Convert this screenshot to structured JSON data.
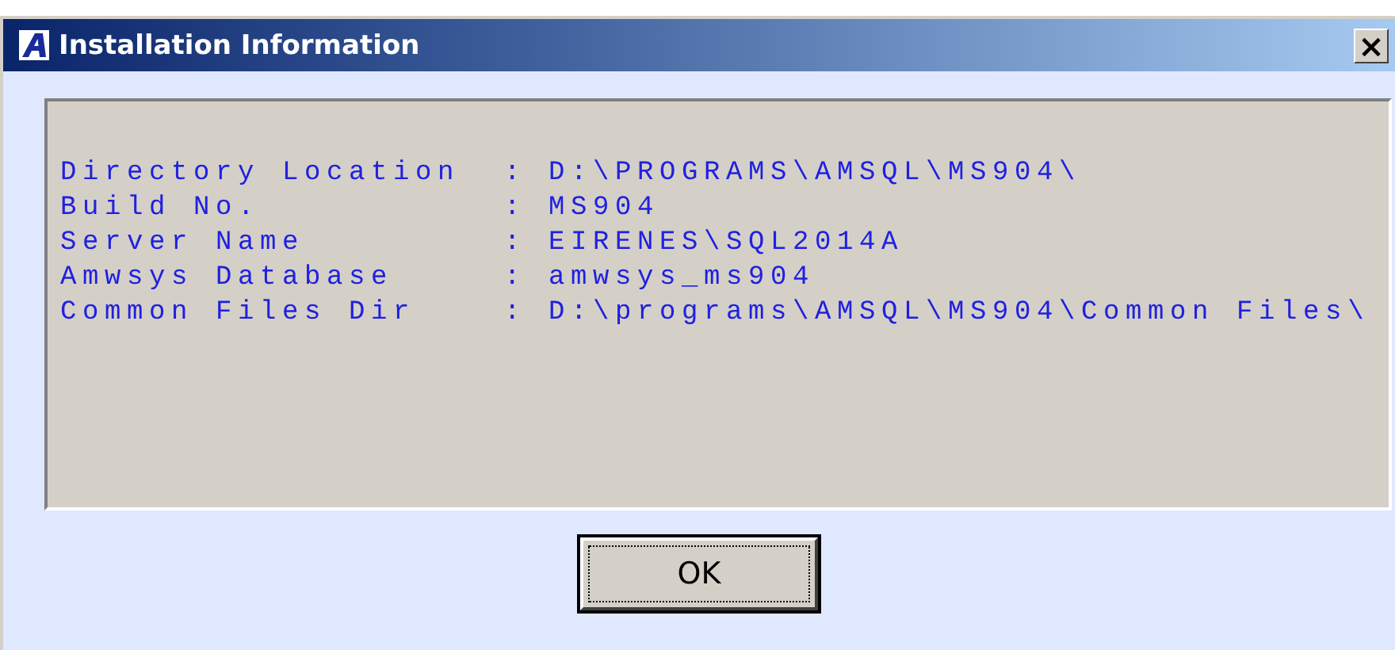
{
  "window": {
    "title": "Installation Information",
    "close_label": "×"
  },
  "info_rows": [
    {
      "label": "Directory Location",
      "value": ": D:\\PROGRAMS\\AMSQL\\MS904\\"
    },
    {
      "label": "Build No.",
      "value": ": MS904"
    },
    {
      "label": "Server Name",
      "value": ": EIRENES\\SQL2014A"
    },
    {
      "label": "Amwsys Database",
      "value": ": amwsys_ms904"
    },
    {
      "label": "Common Files Dir",
      "value": ": D:\\programs\\AMSQL\\MS904\\Common Files\\"
    }
  ],
  "buttons": [
    {
      "label": "OK",
      "default": true
    }
  ]
}
